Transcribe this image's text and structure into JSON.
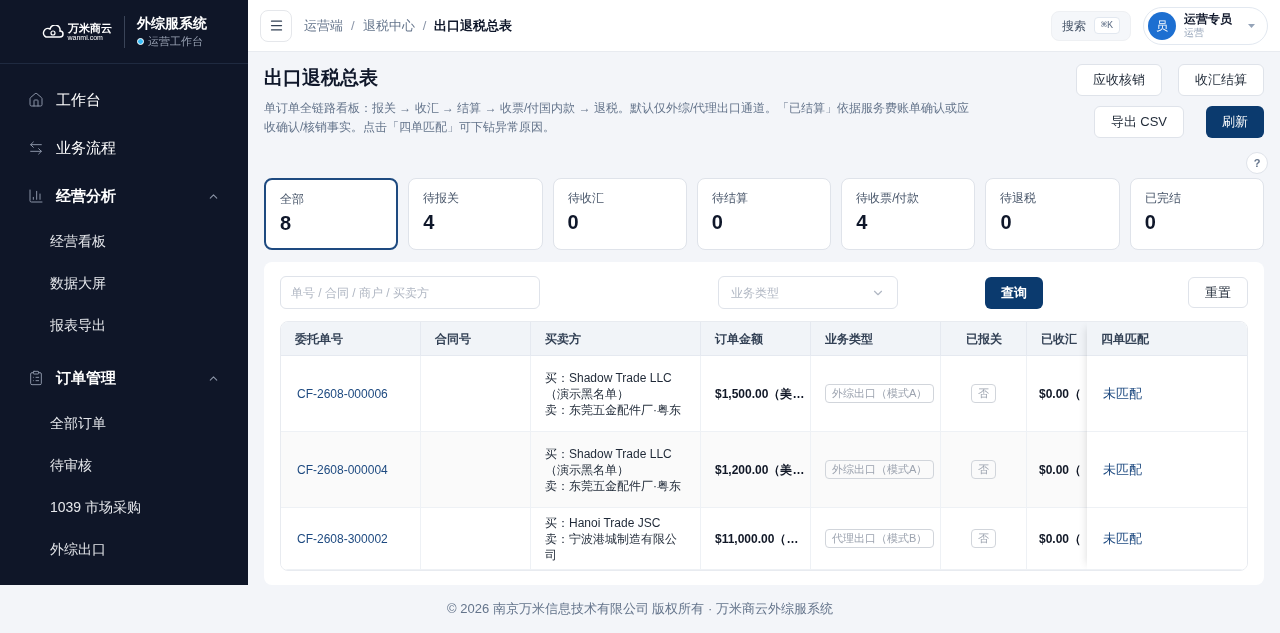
{
  "brand": {
    "logo_text": "万米商云",
    "logo_domain": "wanmi.com",
    "title": "外综服系统",
    "subtitle": "运营工作台"
  },
  "sidebar": {
    "items": [
      {
        "label": "工作台"
      },
      {
        "label": "业务流程"
      },
      {
        "label": "经营分析",
        "expanded": true,
        "children": [
          {
            "label": "经营看板"
          },
          {
            "label": "数据大屏"
          },
          {
            "label": "报表导出"
          }
        ]
      },
      {
        "label": "订单管理",
        "expanded": true,
        "children": [
          {
            "label": "全部订单"
          },
          {
            "label": "待审核"
          },
          {
            "label": "1039 市场采购"
          },
          {
            "label": "外综出口"
          }
        ]
      }
    ]
  },
  "header": {
    "separator": "/",
    "breadcrumbs": [
      "运营端",
      "退税中心",
      "出口退税总表"
    ],
    "search": {
      "label": "搜索",
      "shortcut": "⌘K"
    },
    "user": {
      "avatar": "员",
      "name": "运营专员",
      "role": "运营"
    }
  },
  "page": {
    "title": "出口退税总表",
    "description": "单订单全链路看板：报关 → 收汇 → 结算 → 收票/付国内款 → 退税。默认仅外综/代理出口通道。「已结算」依据服务费账单确认或应收确认/核销事实。点击「四单匹配」可下钻异常原因。",
    "actions_top": [
      "应收核销",
      "收汇结算"
    ],
    "actions_bottom": [
      "导出 CSV",
      "刷新"
    ],
    "help": "?"
  },
  "stats": [
    {
      "label": "全部",
      "value": "8",
      "selected": true
    },
    {
      "label": "待报关",
      "value": "4",
      "selected": false
    },
    {
      "label": "待收汇",
      "value": "0",
      "selected": false
    },
    {
      "label": "待结算",
      "value": "0",
      "selected": false
    },
    {
      "label": "待收票/付款",
      "value": "4",
      "selected": false
    },
    {
      "label": "待退税",
      "value": "0",
      "selected": false
    },
    {
      "label": "已完结",
      "value": "0",
      "selected": false
    }
  ],
  "filters": {
    "search_placeholder": "单号 / 合同 / 商户 / 买卖方",
    "type_placeholder": "业务类型",
    "query": "查询",
    "reset": "重置"
  },
  "table": {
    "columns": [
      "委托单号",
      "合同号",
      "买卖方",
      "订单金额",
      "业务类型",
      "已报关",
      "已收汇",
      "四单匹配"
    ],
    "rows": [
      {
        "order_no": "CF-2608-000006",
        "parties": [
          "买：Shadow Trade LLC（演示黑名单）",
          "卖：东莞五金配件厂·粤东"
        ],
        "amount": "$1,500.00（美…",
        "business_type": "外综出口（模式A）",
        "declared": "否",
        "received": "$0.00（",
        "match": "未匹配"
      },
      {
        "order_no": "CF-2608-000004",
        "parties": [
          "买：Shadow Trade LLC（演示黑名单）",
          "卖：东莞五金配件厂·粤东"
        ],
        "amount": "$1,200.00（美…",
        "business_type": "外综出口（模式A）",
        "declared": "否",
        "received": "$0.00（",
        "match": "未匹配"
      },
      {
        "order_no": "CF-2608-300002",
        "parties": [
          "买：Hanoi Trade JSC",
          "卖：宁波港城制造有限公司"
        ],
        "amount": "$11,000.00（…",
        "business_type": "代理出口（模式B）",
        "declared": "否",
        "received": "$0.00（",
        "match": "未匹配"
      }
    ]
  },
  "footer": "© 2026 南京万米信息技术有限公司 版权所有 · 万米商云外综服系统"
}
